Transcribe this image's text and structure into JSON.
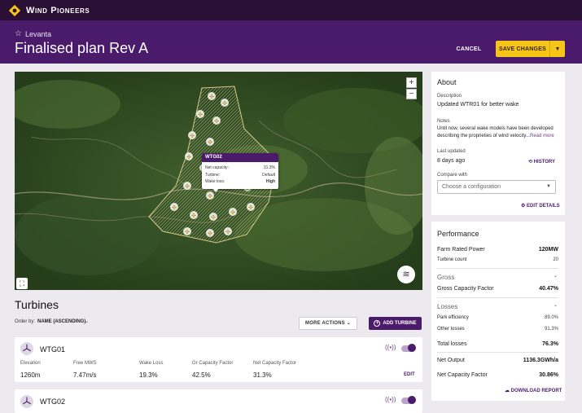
{
  "app": {
    "brand": "Wind Pioneers"
  },
  "header": {
    "project": "Levanta",
    "title": "Finalised plan Rev A",
    "cancel_label": "CANCEL",
    "save_label": "SAVE CHANGES"
  },
  "map": {
    "zoom_in": "+",
    "zoom_out": "−",
    "popup": {
      "title": "WTG02",
      "rows": [
        {
          "label": "Net capacity:",
          "value": "31.3%"
        },
        {
          "label": "Turbine:",
          "value": "Default"
        },
        {
          "label": "Wake loss:",
          "value": "High"
        }
      ]
    }
  },
  "turbines": {
    "title": "Turbines",
    "order_label": "Order by:",
    "order_value": "NAME (ASCENDING)",
    "more_actions": "MORE ACTIONS",
    "add_turbine": "ADD TURBINE",
    "edit_label": "EDIT",
    "metric_labels": [
      "Elevation",
      "Free MWS",
      "Wake Loss",
      "Gr Capacity Factor",
      "Net Capacity Factor"
    ],
    "items": [
      {
        "name": "WTG01",
        "enabled": true,
        "values": [
          "1260m",
          "7.47m/s",
          "19.3%",
          "42.5%",
          "31.3%"
        ]
      },
      {
        "name": "WTG02",
        "enabled": true
      }
    ]
  },
  "about": {
    "title": "About",
    "description_label": "Description",
    "description": "Updated WTR01 for better wake",
    "notes_label": "Notes",
    "notes_line1": "Until now, several wake models have been developed",
    "notes_line2": "describing the proprieties of wind velocity...",
    "read_more": "Read more",
    "last_updated_label": "Last updated",
    "last_updated": "8 days ago",
    "history": "HISTORY",
    "compare_label": "Compare with",
    "compare_placeholder": "Choose a configuration",
    "edit_details": "EDIT DETAILS"
  },
  "performance": {
    "title": "Performance",
    "farm_rated_power_label": "Farm Rated Power",
    "farm_rated_power": "120MW",
    "turbine_count_label": "Turbine count",
    "turbine_count": "20",
    "gross_title": "Gross",
    "gross_cf_label": "Gross Capacity Factor",
    "gross_cf": "40.47%",
    "losses_title": "Losses",
    "park_eff_label": "Park efficiency",
    "park_eff": "89.0%",
    "other_losses_label": "Other losses",
    "other_losses": "91.3%",
    "total_losses_label": "Total losses",
    "total_losses": "76.3%",
    "net_output_label": "Net Output",
    "net_output": "1136.3GWh/a",
    "net_cf_label": "Net Capacity Factor",
    "net_cf": "30.86%",
    "download": "DOWNLOAD REPORT"
  },
  "colors": {
    "brand_dark": "#2a0f35",
    "brand": "#4b1b6b",
    "accent": "#f5c518"
  }
}
